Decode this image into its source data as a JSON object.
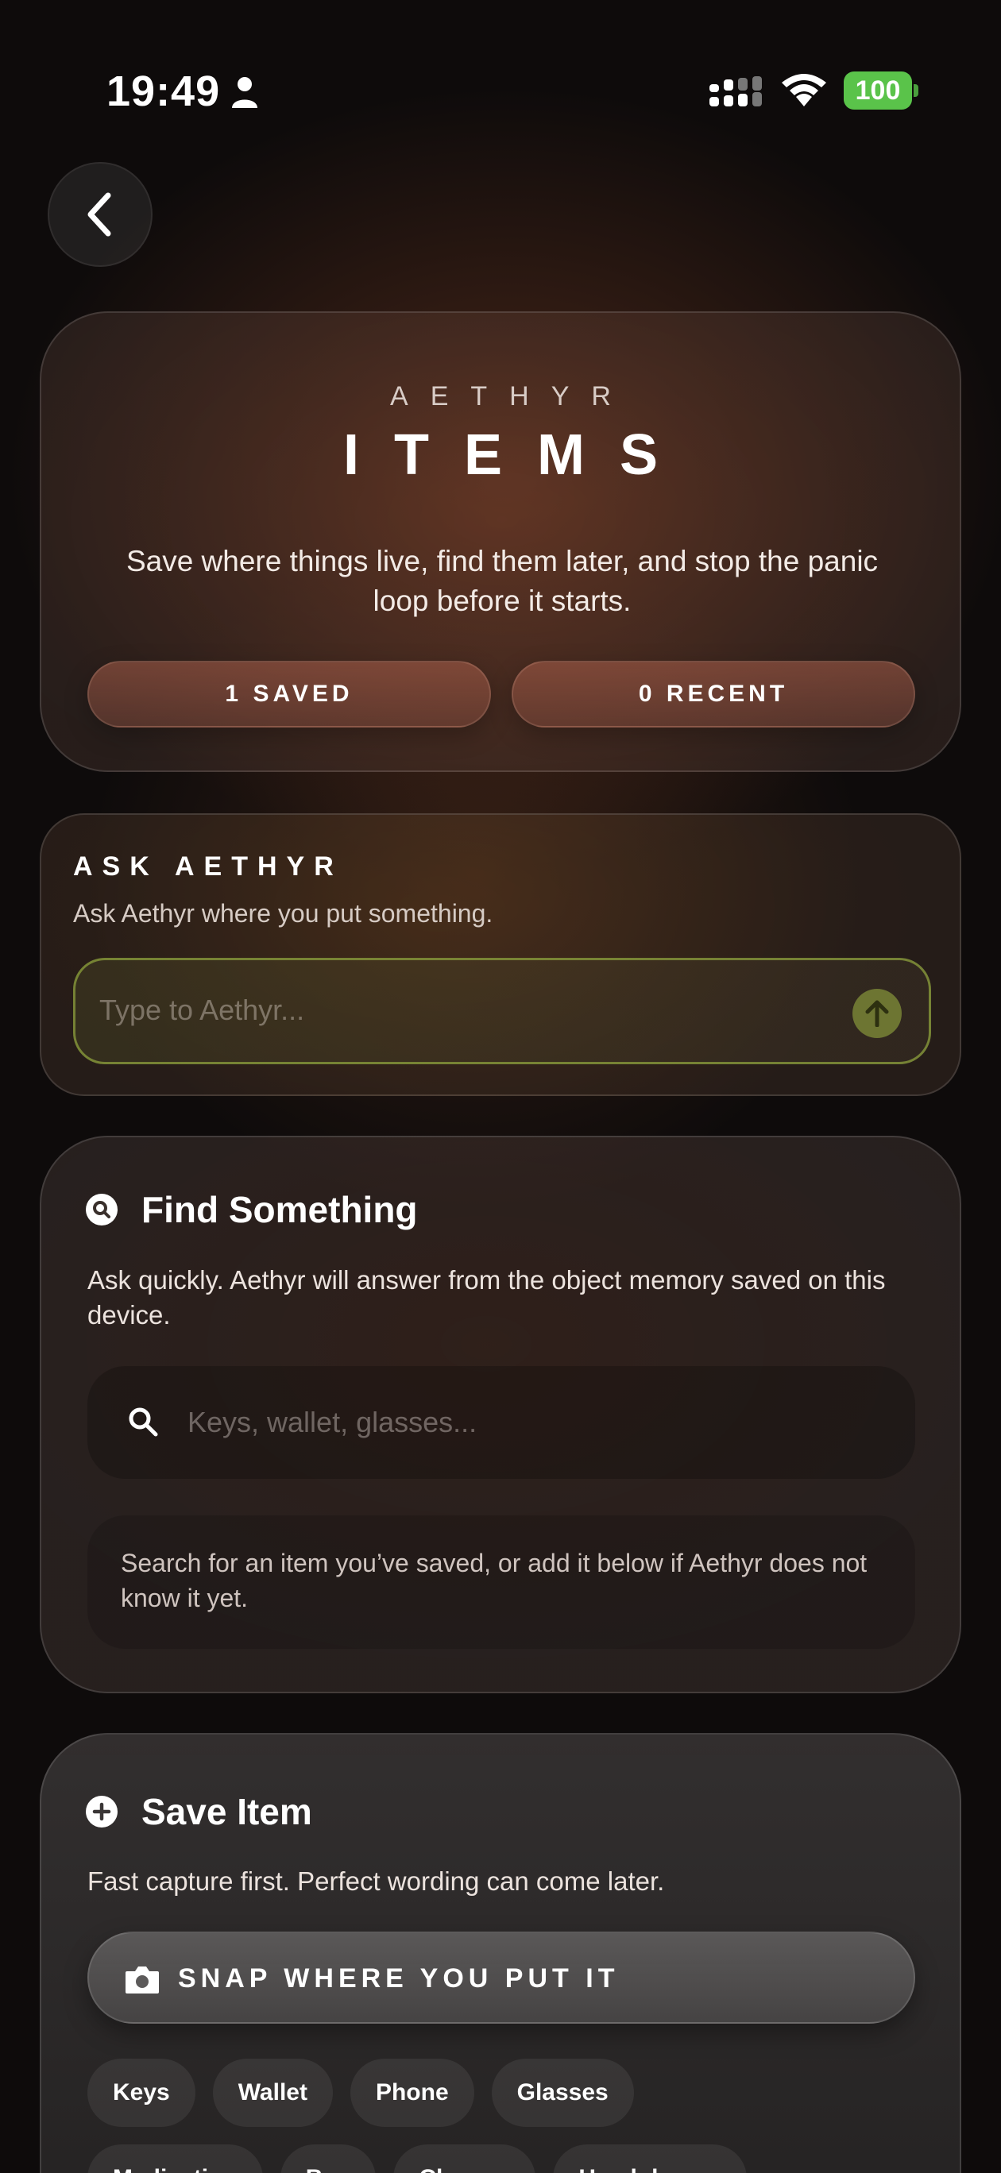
{
  "status_bar": {
    "time": "19:49",
    "battery": "100"
  },
  "hero": {
    "eyebrow": "AETHYR",
    "title": "ITEMS",
    "description": "Save where things live, find them later, and stop the panic loop before it starts.",
    "saved_label": "1 SAVED",
    "recent_label": "0 RECENT"
  },
  "ask": {
    "title": "ASK AETHYR",
    "subtitle": "Ask Aethyr where you put something.",
    "placeholder": "Type to Aethyr..."
  },
  "find": {
    "title": "Find Something",
    "description": "Ask quickly. Aethyr will answer from the object memory saved on this device.",
    "search_placeholder": "Keys, wallet, glasses...",
    "hint": "Search for an item you’ve saved, or add it below if Aethyr does not know it yet."
  },
  "save": {
    "title": "Save Item",
    "description": "Fast capture first. Perfect wording can come later.",
    "snap_label": "SNAP WHERE YOU PUT IT",
    "chips_row1": [
      "Keys",
      "Wallet",
      "Phone",
      "Glasses"
    ],
    "chips_row2": [
      "Medication",
      "Bag",
      "Charger",
      "Headphones"
    ]
  },
  "colors": {
    "accent_green": "#6d7532",
    "battery_green": "#5ac34a",
    "pill_rose": "#a05f4b"
  }
}
